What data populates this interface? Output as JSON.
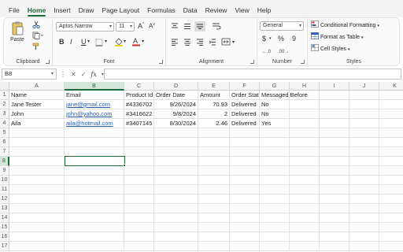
{
  "menu": {
    "tabs": [
      "File",
      "Home",
      "Insert",
      "Draw",
      "Page Layout",
      "Formulas",
      "Data",
      "Review",
      "View",
      "Help"
    ]
  },
  "ribbon": {
    "clipboard": {
      "paste_label": "Paste",
      "group_label": "Clipboard"
    },
    "font": {
      "font_name": "Aptos Narrow",
      "font_size": "11",
      "group_label": "Font",
      "bold": "B",
      "italic": "I",
      "underline": "U",
      "grow": "A",
      "shrink": "A"
    },
    "alignment": {
      "group_label": "Alignment"
    },
    "number": {
      "format": "General",
      "currency": "$",
      "percent": "%",
      "comma": "9",
      "group_label": "Number"
    },
    "styles": {
      "conditional": "Conditional Formatting",
      "format_table": "Format as Table",
      "cell_styles": "Cell Styles",
      "group_label": "Styles"
    }
  },
  "formula_bar": {
    "name_box": "B8",
    "fx": "fx",
    "formula": ""
  },
  "sheet": {
    "columns": [
      "A",
      "B",
      "C",
      "D",
      "E",
      "F",
      "G",
      "H",
      "I",
      "J",
      "K"
    ],
    "rows": [
      "1",
      "2",
      "3",
      "4",
      "5",
      "6",
      "7",
      "8",
      "9",
      "10",
      "11",
      "12",
      "13",
      "14",
      "15",
      "16",
      "17"
    ],
    "selected_cell": "B8",
    "header": {
      "name": "Name",
      "email": "Email",
      "product_id": "Product Id",
      "order_date": "Order Date",
      "amount": "Amount",
      "order_status": "Order Stat",
      "messaged": "Messaged Before"
    },
    "records": [
      {
        "name": "Jane Tester",
        "email": "jane@gmail.com",
        "product_id": "#4336702",
        "order_date": "9/26/2024",
        "amount": "70.93",
        "status": "Delivered",
        "messaged": "No"
      },
      {
        "name": "John",
        "email": "john@yahoo.com",
        "product_id": "#3416622",
        "order_date": "9/8/2024",
        "amount": "2",
        "status": "Delivered",
        "messaged": "No"
      },
      {
        "name": "Aila",
        "email": "aila@hotmail.com",
        "product_id": "#3407145",
        "order_date": "8/30/2024",
        "amount": "2.46",
        "status": "Delivered",
        "messaged": "Yes"
      }
    ]
  },
  "colors": {
    "accent": "#1e6b3a",
    "link": "#2a5fa8",
    "selection_header": "#d3e6d9"
  }
}
